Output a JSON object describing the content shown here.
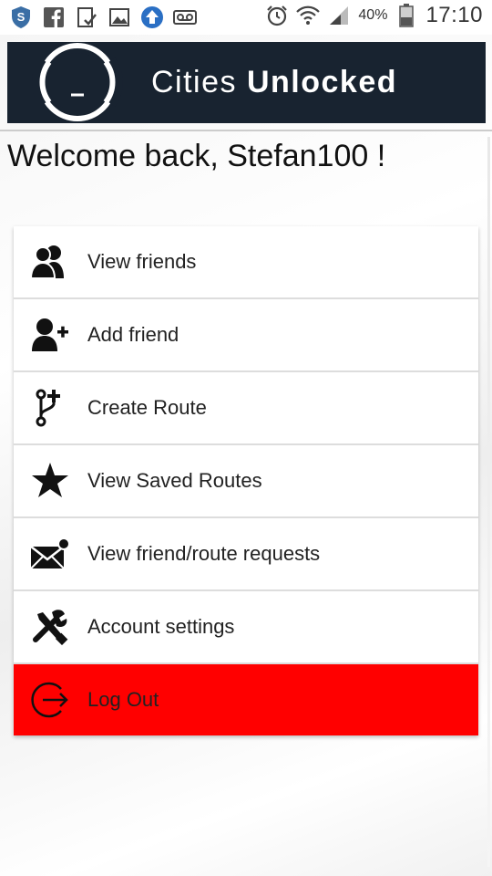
{
  "status_bar": {
    "battery_percent": "40%",
    "time": "17:10"
  },
  "banner": {
    "brand_light": "Cities ",
    "brand_bold": "Unlocked"
  },
  "welcome_text": "Welcome back, Stefan100 !",
  "menu": [
    {
      "label": "View friends",
      "icon": "friends-icon"
    },
    {
      "label": "Add friend",
      "icon": "add-user-icon"
    },
    {
      "label": "Create Route",
      "icon": "create-route-icon"
    },
    {
      "label": "View Saved Routes",
      "icon": "star-icon"
    },
    {
      "label": "View friend/route requests",
      "icon": "mail-notification-icon"
    },
    {
      "label": "Account settings",
      "icon": "tools-icon"
    },
    {
      "label": "Log Out",
      "icon": "logout-icon"
    }
  ],
  "colors": {
    "banner_bg": "#182330",
    "logout_bg": "#ff0000"
  }
}
